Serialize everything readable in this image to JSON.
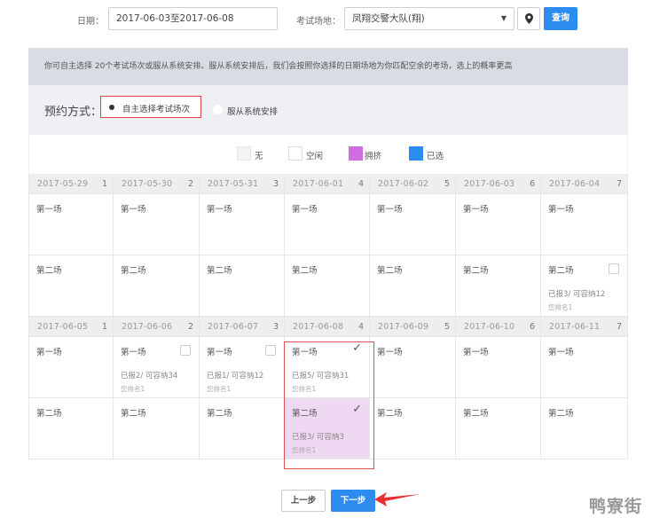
{
  "search": {
    "date_label": "日期：",
    "date_value": "2017-06-03至2017-06-08",
    "location_label": "考试场地：",
    "location_value": "凤翔交警大队(翔)",
    "query_label": "查询",
    "pin_icon": "map-pin-icon"
  },
  "info_text": "你可自主选择 20个考试场次或服从系统安排。服从系统安排后，我们会按照你选择的日期场地为你匹配空余的考场，选上的概率更高",
  "method": {
    "label": "预约方式：",
    "option1": "自主选择考试场次",
    "option2": "服从系统安排"
  },
  "legend": [
    {
      "label": "无",
      "color": "#f3f3f3"
    },
    {
      "label": "空闲",
      "color": "#ffffff"
    },
    {
      "label": "拥挤",
      "color": "#cf6ee0"
    },
    {
      "label": "已选",
      "color": "#2d8cf0"
    }
  ],
  "weeks": [
    {
      "dates": [
        {
          "date": "2017-05-29",
          "weekday": "1"
        },
        {
          "date": "2017-05-30",
          "weekday": "2"
        },
        {
          "date": "2017-05-31",
          "weekday": "3"
        },
        {
          "date": "2017-06-01",
          "weekday": "4"
        },
        {
          "date": "2017-06-02",
          "weekday": "5"
        },
        {
          "date": "2017-06-03",
          "weekday": "6"
        },
        {
          "date": "2017-06-04",
          "weekday": "7"
        }
      ],
      "sessions": [
        [
          {
            "name": "第一场"
          },
          {
            "name": "第一场"
          },
          {
            "name": "第一场"
          },
          {
            "name": "第一场"
          },
          {
            "name": "第一场"
          },
          {
            "name": "第一场"
          },
          {
            "name": "第一场"
          }
        ],
        [
          {
            "name": "第二场"
          },
          {
            "name": "第二场"
          },
          {
            "name": "第二场"
          },
          {
            "name": "第二场"
          },
          {
            "name": "第二场"
          },
          {
            "name": "第二场"
          },
          {
            "name": "第二场",
            "checkbox": true,
            "detail": "已报3/ 可容纳12",
            "rank": "您排名1"
          }
        ]
      ]
    },
    {
      "dates": [
        {
          "date": "2017-06-05",
          "weekday": "1"
        },
        {
          "date": "2017-06-06",
          "weekday": "2"
        },
        {
          "date": "2017-06-07",
          "weekday": "3"
        },
        {
          "date": "2017-06-08",
          "weekday": "4"
        },
        {
          "date": "2017-06-09",
          "weekday": "5"
        },
        {
          "date": "2017-06-10",
          "weekday": "6"
        },
        {
          "date": "2017-06-11",
          "weekday": "7"
        }
      ],
      "sessions": [
        [
          {
            "name": "第一场"
          },
          {
            "name": "第一场",
            "checkbox": true,
            "detail": "已报2/ 可容纳34",
            "rank": "您排名1"
          },
          {
            "name": "第一场",
            "checkbox": true,
            "detail": "已报1/ 可容纳12",
            "rank": "您排名1"
          },
          {
            "name": "第一场",
            "checked": true,
            "detail": "已报5/ 可容纳31",
            "rank": "您排名1"
          },
          {
            "name": "第一场"
          },
          {
            "name": "第一场"
          },
          {
            "name": "第一场"
          }
        ],
        [
          {
            "name": "第二场"
          },
          {
            "name": "第二场"
          },
          {
            "name": "第二场"
          },
          {
            "name": "第二场",
            "checked": true,
            "crowded": true,
            "detail": "已报3/ 可容纳3",
            "rank": "您排名1"
          },
          {
            "name": "第二场"
          },
          {
            "name": "第二场"
          },
          {
            "name": "第二场"
          }
        ]
      ]
    }
  ],
  "buttons": {
    "prev": "上一步",
    "next": "下一步"
  },
  "watermark": "鸭寮街",
  "colors": {
    "accent": "#2d8cf0",
    "highlight": "#e05050",
    "arrow": "#e83030"
  }
}
